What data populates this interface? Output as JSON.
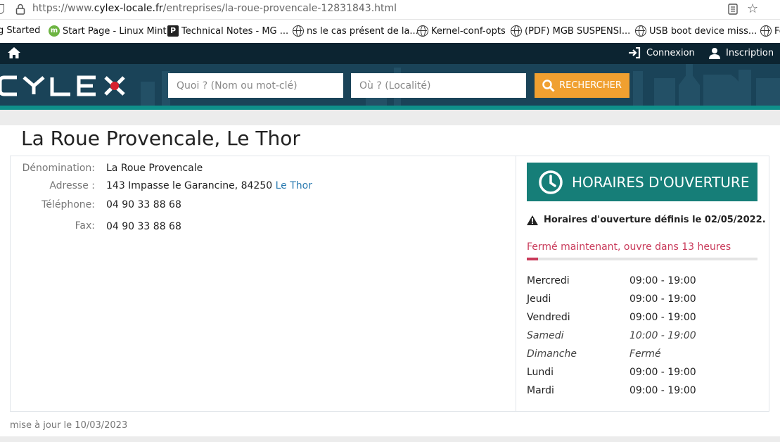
{
  "browser": {
    "url_prefix": "https://www.",
    "url_domain": "cylex-locale.fr",
    "url_path": "/entreprises/la-roue-provencale-12831843.html"
  },
  "bookmarks": [
    {
      "label": "g Started",
      "icon": "none"
    },
    {
      "label": "Start Page - Linux Mint",
      "icon": "mint-icon"
    },
    {
      "label": "Technical Notes - MG ...",
      "icon": "p-icon"
    },
    {
      "label": "ns le cas présent de la...",
      "icon": "globe-icon"
    },
    {
      "label": "Kernel-conf-opts",
      "icon": "globe-icon"
    },
    {
      "label": "(PDF) MGB SUSPENSI...",
      "icon": "globe-icon"
    },
    {
      "label": "USB boot device miss...",
      "icon": "globe-icon"
    },
    {
      "label": "Fe",
      "icon": "globe-icon"
    }
  ],
  "header": {
    "login_label": "Connexion",
    "signup_label": "Inscription",
    "logo_text": "CYLEX",
    "search_what_placeholder": "Quoi ? (Nom ou mot-clé)",
    "search_where_placeholder": "Où ? (Localité)",
    "search_button_label": "RECHERCHER"
  },
  "business": {
    "title": "La Roue Provencale, Le Thor",
    "fields": {
      "name_label": "Dénomination:",
      "name_value": "La Roue Provencale",
      "address_label": "Adresse :",
      "address_value": "143 Impasse le Garancine, 84250",
      "address_city_link": "Le Thor",
      "phone_label": "Téléphone:",
      "phone_value": "04 90 33 88 68",
      "fax_label": "Fax:",
      "fax_value": "04 90 33 88 68"
    }
  },
  "hours": {
    "banner_title": "HORAIRES D'OUVERTURE",
    "warning": "Horaires d'ouverture définis le 02/05/2022.",
    "status": "Fermé maintenant, ouvre dans 13 heures",
    "progress_fraction": 0.05,
    "days": [
      {
        "day": "Mercredi",
        "time": "09:00 - 19:00",
        "italic": false
      },
      {
        "day": "Jeudi",
        "time": "09:00 - 19:00",
        "italic": false
      },
      {
        "day": "Vendredi",
        "time": "09:00 - 19:00",
        "italic": false
      },
      {
        "day": "Samedi",
        "time": "10:00 - 19:00",
        "italic": true
      },
      {
        "day": "Dimanche",
        "time": "Fermé",
        "italic": true
      },
      {
        "day": "Lundi",
        "time": "09:00 - 19:00",
        "italic": false
      },
      {
        "day": "Mardi",
        "time": "09:00 - 19:00",
        "italic": false
      }
    ]
  },
  "footer": {
    "updated": "mise à jour le 10/03/2023"
  },
  "colors": {
    "header_bg": "#1a4358",
    "teal": "#167e78",
    "search_button": "#f0a030",
    "status_red": "#c93a5a",
    "link_blue": "#2a7ab0"
  }
}
